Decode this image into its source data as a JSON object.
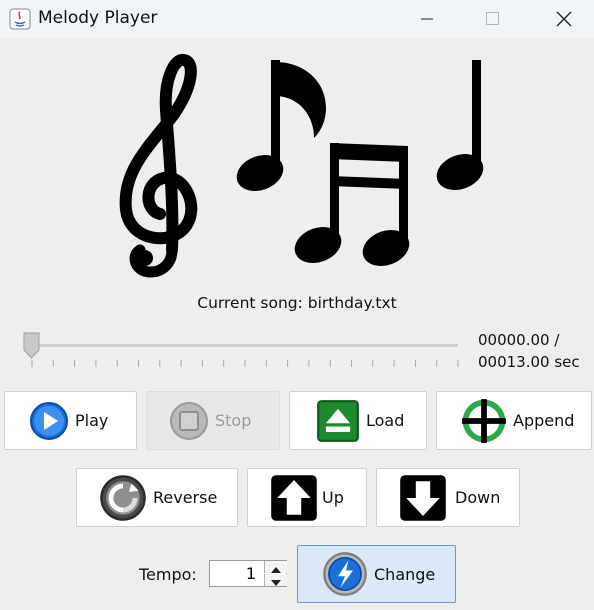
{
  "window": {
    "title": "Melody Player"
  },
  "status": {
    "current_song": "Current song: birthday.txt"
  },
  "progress": {
    "position": 0,
    "elapsed": "00000.00 /",
    "total": "00013.00 sec"
  },
  "buttons": {
    "play": "Play",
    "stop": "Stop",
    "load": "Load",
    "append": "Append",
    "reverse": "Reverse",
    "up": "Up",
    "down": "Down",
    "change": "Change"
  },
  "tempo": {
    "label": "Tempo:",
    "value": "1"
  },
  "icons": {
    "app": "java-icon",
    "play": "play-icon",
    "stop": "stop-icon",
    "load": "eject-icon",
    "append": "crosshair-icon",
    "reverse": "reverse-icon",
    "up": "arrow-up-icon",
    "down": "arrow-down-icon",
    "change": "lightning-icon"
  },
  "colors": {
    "play_blue": "#1a6fd8",
    "load_green": "#1e8a2e",
    "append_green": "#2fa84a",
    "focus_border": "#6a9ad0"
  }
}
